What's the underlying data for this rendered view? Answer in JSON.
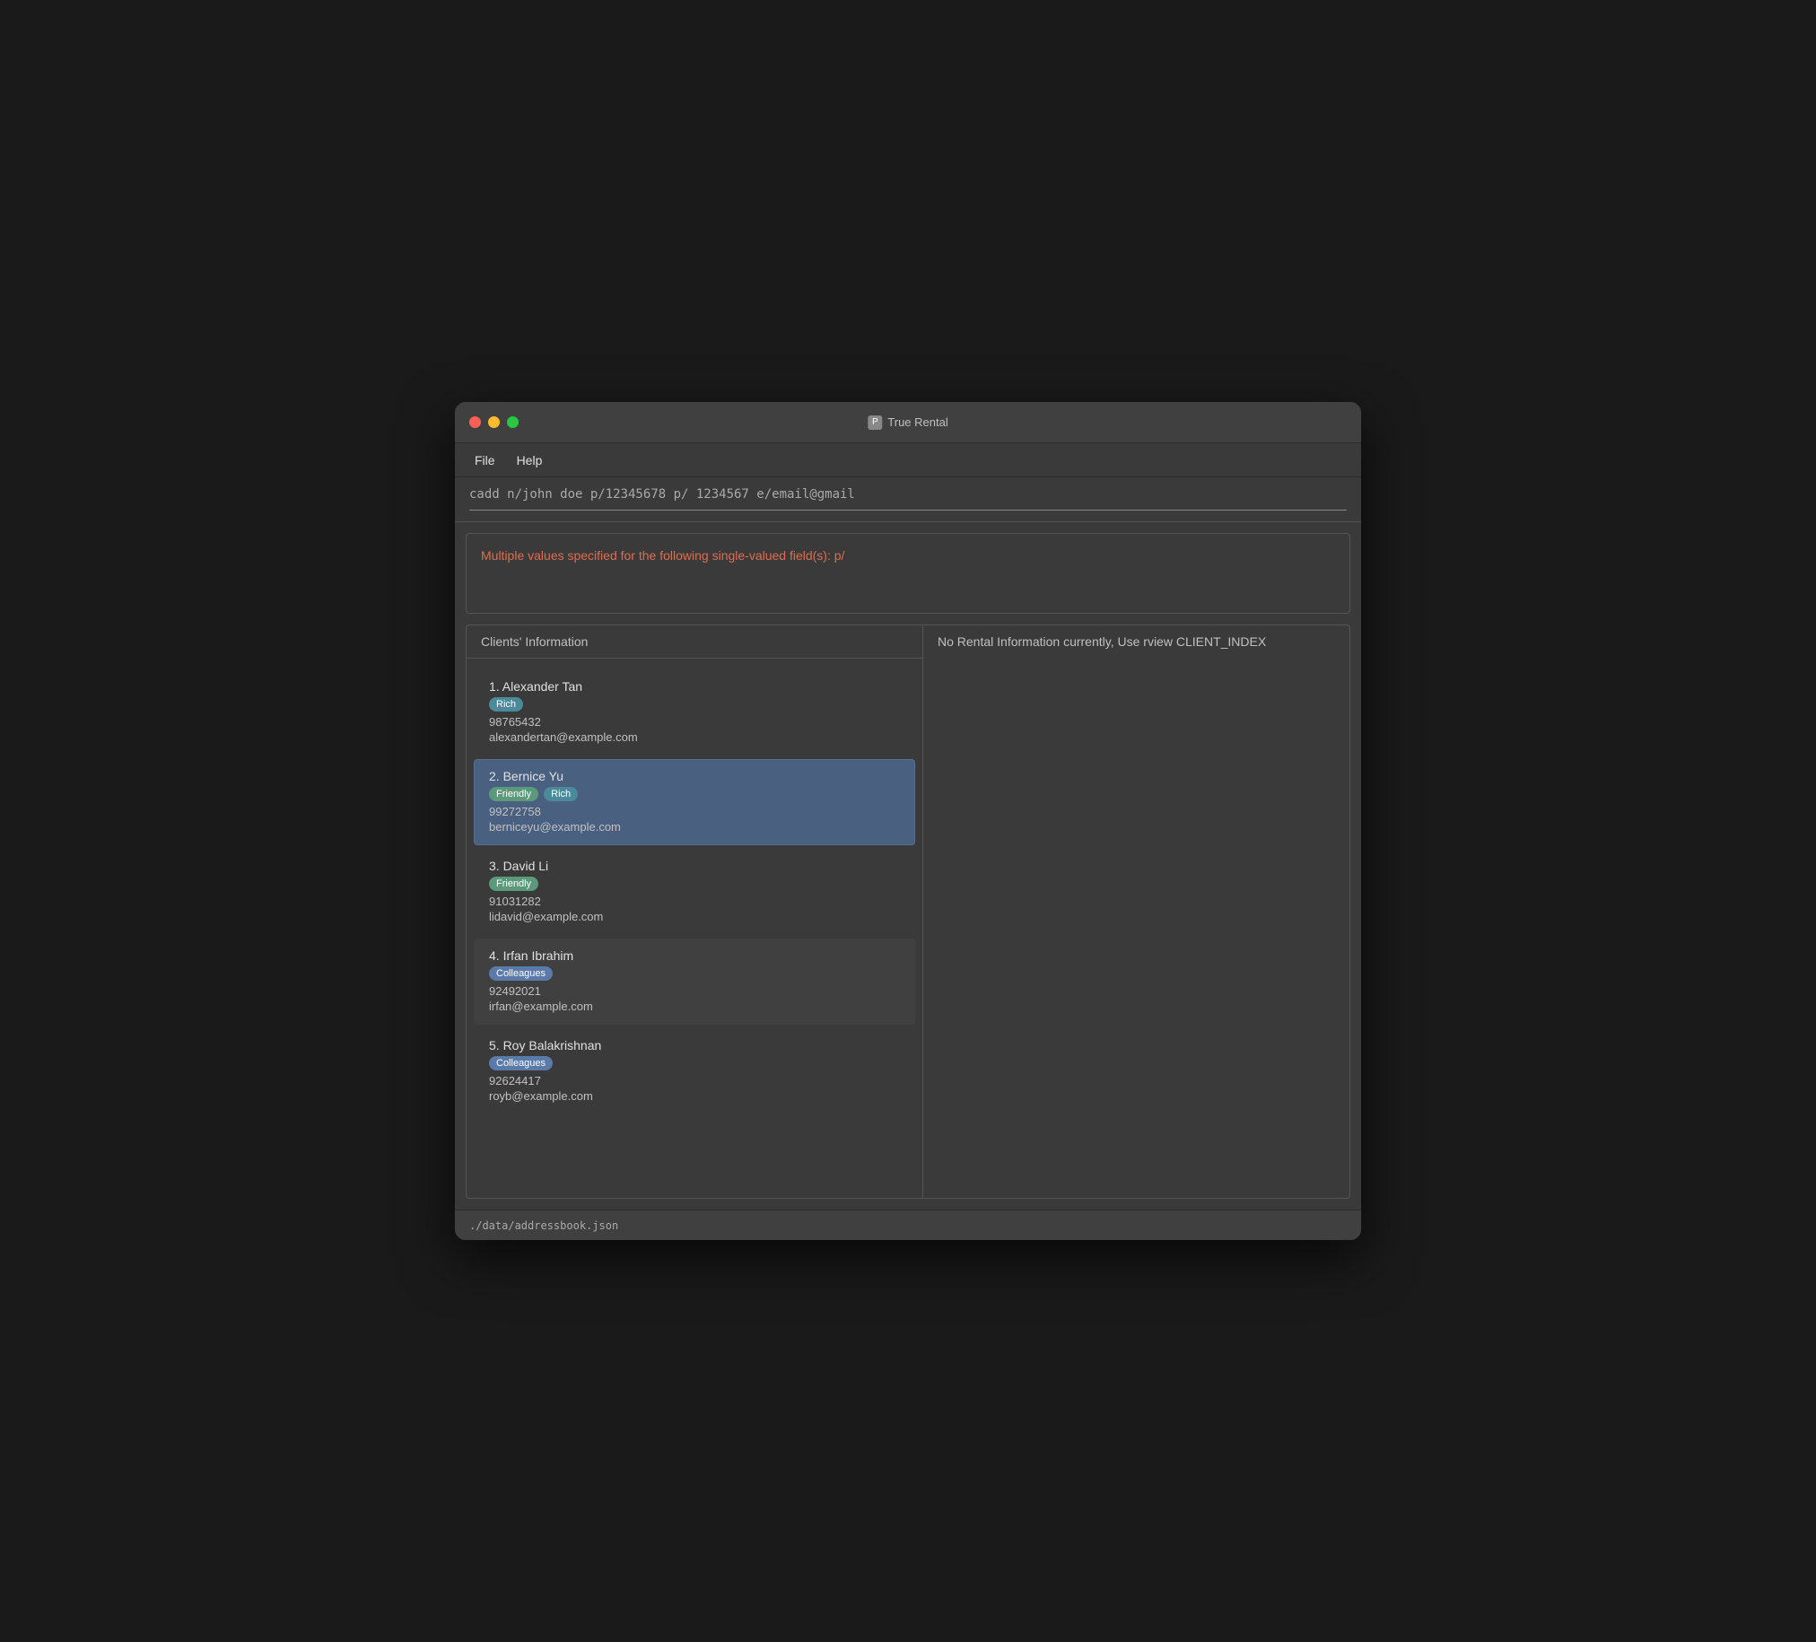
{
  "window": {
    "title": "True Rental"
  },
  "menu": {
    "items": [
      {
        "label": "File"
      },
      {
        "label": "Help"
      }
    ]
  },
  "command": {
    "value": "cadd n/john doe p/12345678 p/ 1234567 e/email@gmail"
  },
  "error": {
    "message": "Multiple values specified for the following single-valued field(s): p/"
  },
  "clients_panel": {
    "title": "Clients' Information",
    "clients": [
      {
        "index": 1,
        "name": "Alexander Tan",
        "tags": [
          "Rich"
        ],
        "phone": "98765432",
        "email": "alexandertan@example.com",
        "selected": false,
        "highlighted": false
      },
      {
        "index": 2,
        "name": "Bernice Yu",
        "tags": [
          "Friendly",
          "Rich"
        ],
        "phone": "99272758",
        "email": "berniceyu@example.com",
        "selected": true,
        "highlighted": false
      },
      {
        "index": 3,
        "name": "David Li",
        "tags": [
          "Friendly"
        ],
        "phone": "91031282",
        "email": "lidavid@example.com",
        "selected": false,
        "highlighted": false
      },
      {
        "index": 4,
        "name": "Irfan Ibrahim",
        "tags": [
          "Colleagues"
        ],
        "phone": "92492021",
        "email": "irfan@example.com",
        "selected": false,
        "highlighted": true
      },
      {
        "index": 5,
        "name": "Roy Balakrishnan",
        "tags": [
          "Colleagues"
        ],
        "phone": "92624417",
        "email": "royb@example.com",
        "selected": false,
        "highlighted": false
      }
    ]
  },
  "rental_panel": {
    "empty_message": "No Rental Information currently, Use rview CLIENT_INDEX"
  },
  "status_bar": {
    "path": "./data/addressbook.json"
  },
  "tag_map": {
    "Rich": "tag-rich",
    "Friendly": "tag-friendly",
    "Colleagues": "tag-colleagues"
  }
}
